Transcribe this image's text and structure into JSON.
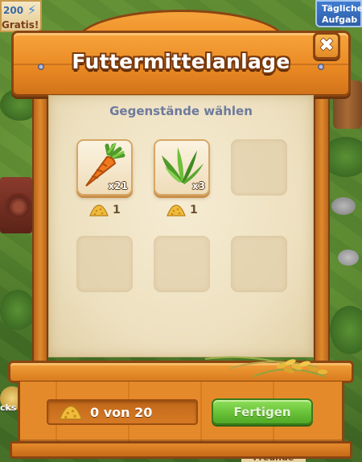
{
  "background": {
    "promo_left": {
      "line1": "200",
      "line2": "Gratis!"
    },
    "promo_right": {
      "line1": "Tägliche",
      "line2": "Aufgab"
    },
    "side_label_left": "cks",
    "bottom_tab": "Freunde"
  },
  "dialog": {
    "title": "Futtermittelanlage",
    "close_icon": "close-icon",
    "subtitle": "Gegenstände wählen",
    "items": [
      {
        "name": "Karotte",
        "icon": "carrot-icon",
        "quantity": "x21",
        "cost": "1"
      },
      {
        "name": "Gras",
        "icon": "grass-icon",
        "quantity": "x3",
        "cost": "1"
      }
    ],
    "empty_slots": 4,
    "footer": {
      "amount": "0 von 20",
      "craft_label": "Fertigen"
    }
  },
  "colors": {
    "wood": "#ea8a24",
    "wood_dark": "#8a4512",
    "parchment": "#f3e7c9",
    "subtitle": "#6d7a9c",
    "button_green": "#6cc43a"
  }
}
